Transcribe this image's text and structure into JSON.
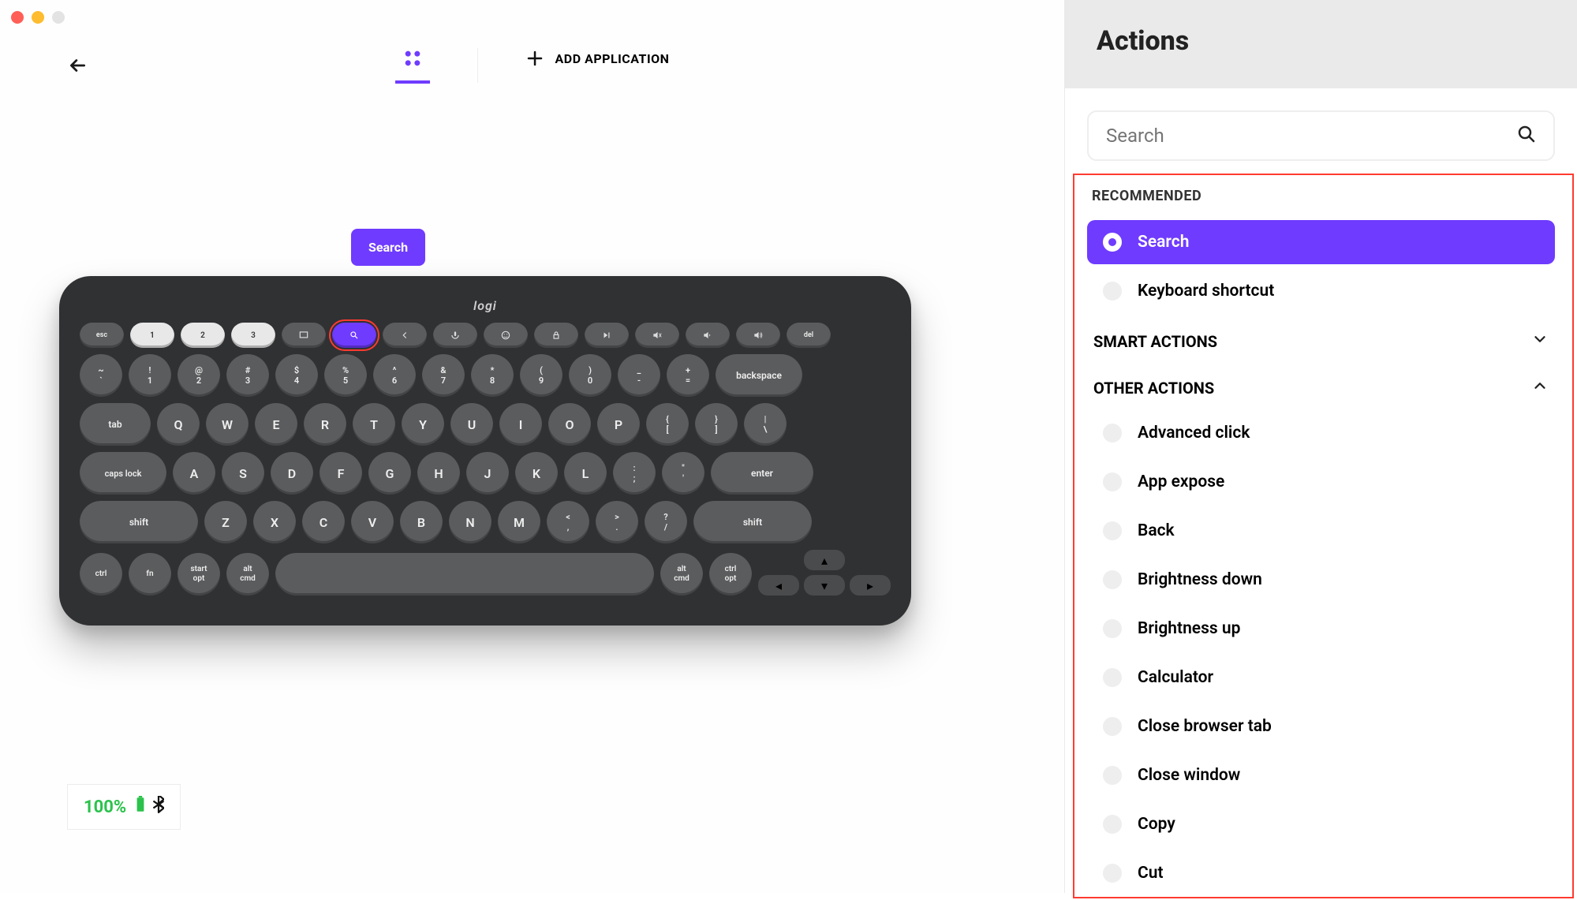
{
  "top": {
    "add_app_label": "ADD APPLICATION"
  },
  "status": {
    "battery_pct": "100%"
  },
  "tooltip": {
    "label": "Search"
  },
  "keyboard": {
    "brand": "logi",
    "esc": "esc",
    "fkeys_light": [
      "1",
      "2",
      "3"
    ],
    "row1": {
      "keys": [
        "~\n`",
        "!\n1",
        "@\n2",
        "#\n3",
        "$\n4",
        "%\n5",
        "^\n6",
        "&\n7",
        "*\n8",
        "(\n9",
        ")\n0",
        "_\n-",
        "+\n="
      ],
      "backspace": "backspace"
    },
    "row2": {
      "tab": "tab",
      "keys": [
        "Q",
        "W",
        "E",
        "R",
        "T",
        "Y",
        "U",
        "I",
        "O",
        "P"
      ],
      "brackets": [
        "{\n[",
        "}\n]"
      ],
      "slash": "|\n\\"
    },
    "row3": {
      "caps": "caps lock",
      "keys": [
        "A",
        "S",
        "D",
        "F",
        "G",
        "H",
        "J",
        "K",
        "L"
      ],
      "punct": [
        ":\n;",
        "\"\n'"
      ],
      "enter": "enter"
    },
    "row4": {
      "lshift": "shift",
      "keys": [
        "Z",
        "X",
        "C",
        "V",
        "B",
        "N",
        "M"
      ],
      "punct": [
        "<\n,",
        ">\n.",
        "?\n/"
      ],
      "rshift": "shift"
    },
    "row5": {
      "ctrl": "ctrl",
      "fn": "fn",
      "start": "start\nopt",
      "alt": "alt\ncmd",
      "alt2": "alt\ncmd",
      "ctrl2": "ctrl\nopt"
    },
    "del": "del"
  },
  "sidebar": {
    "title": "Actions",
    "search_placeholder": "Search",
    "recommended_label": "RECOMMENDED",
    "recommended_items": [
      {
        "label": "Search",
        "selected": true
      },
      {
        "label": "Keyboard shortcut",
        "selected": false
      }
    ],
    "smart_actions_label": "SMART ACTIONS",
    "smart_actions_expanded": false,
    "other_actions_label": "OTHER ACTIONS",
    "other_actions_expanded": true,
    "other_actions": [
      "Advanced click",
      "App expose",
      "Back",
      "Brightness down",
      "Brightness up",
      "Calculator",
      "Close browser tab",
      "Close window",
      "Copy",
      "Cut"
    ]
  }
}
